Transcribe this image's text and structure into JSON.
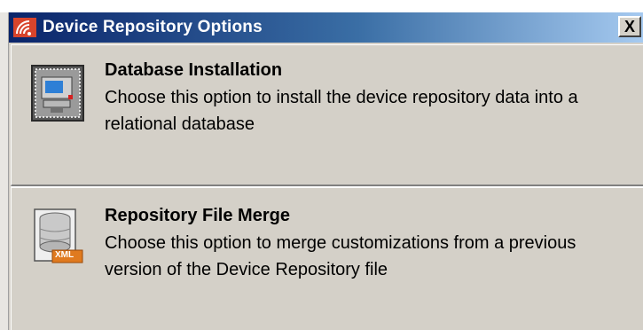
{
  "window": {
    "title": "Device Repository Options",
    "close_label": "X"
  },
  "options": [
    {
      "title": "Database Installation",
      "description": "Choose this option to install the device repository data into a relational database",
      "icon": "database-installation-icon"
    },
    {
      "title": "Repository File Merge",
      "description": "Choose this option to merge customizations from a previous version of the Device Repository file",
      "icon": "xml-file-merge-icon",
      "icon_badge": "XML"
    }
  ],
  "colors": {
    "titlebar_start": "#0a246a",
    "titlebar_end": "#a6caf0",
    "panel_bg": "#d4d0c8",
    "xml_badge": "#e07a1f"
  }
}
